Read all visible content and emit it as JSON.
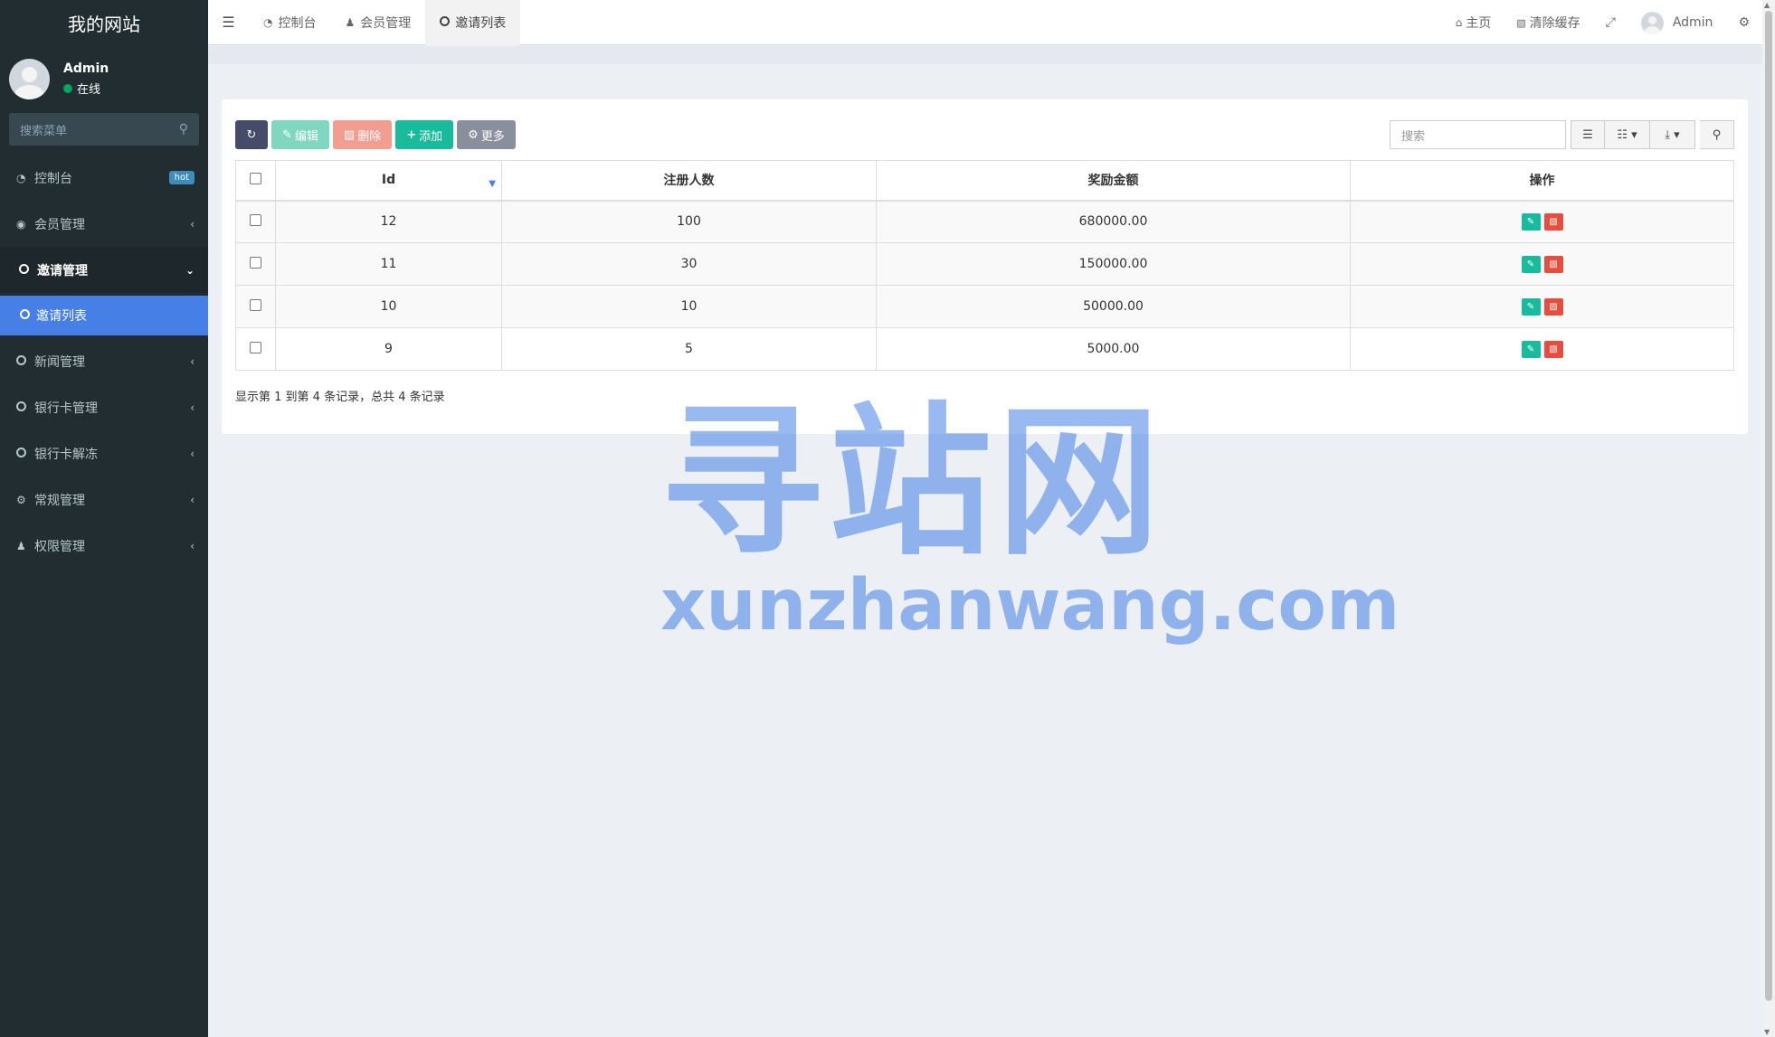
{
  "brand": "我的网站",
  "user": {
    "name": "Admin",
    "status": "在线"
  },
  "sidebar": {
    "search_placeholder": "搜索菜单",
    "items": [
      {
        "label": "控制台",
        "icon": "dashboard-icon",
        "badge": "hot"
      },
      {
        "label": "会员管理",
        "icon": "user-circle-icon"
      },
      {
        "label": "邀请管理",
        "icon": "circle-o-icon",
        "open": true
      },
      {
        "label": "新闻管理",
        "icon": "circle-o-icon"
      },
      {
        "label": "银行卡管理",
        "icon": "circle-o-icon"
      },
      {
        "label": "银行卡解冻",
        "icon": "circle-o-icon"
      },
      {
        "label": "常规管理",
        "icon": "cogs-icon"
      },
      {
        "label": "权限管理",
        "icon": "users-icon"
      }
    ],
    "submenu_active": "邀请列表"
  },
  "topnav": {
    "tabs": [
      {
        "label": "控制台",
        "icon": "dashboard-icon"
      },
      {
        "label": "会员管理",
        "icon": "user-icon"
      },
      {
        "label": "邀请列表",
        "icon": "circle-o-icon",
        "active": true
      }
    ],
    "home": "主页",
    "clear_cache": "清除缓存",
    "admin": "Admin"
  },
  "toolbar": {
    "edit": "编辑",
    "delete": "删除",
    "add": "添加",
    "more": "更多",
    "search_placeholder": "搜索"
  },
  "table": {
    "columns": [
      "Id",
      "注册人数",
      "奖励金额",
      "操作"
    ],
    "rows": [
      {
        "id": "12",
        "count": "100",
        "amount": "680000.00"
      },
      {
        "id": "11",
        "count": "30",
        "amount": "150000.00"
      },
      {
        "id": "10",
        "count": "10",
        "amount": "50000.00"
      },
      {
        "id": "9",
        "count": "5",
        "amount": "5000.00"
      }
    ]
  },
  "pagination_info": "显示第 1 到第 4 条记录，总共 4 条记录",
  "watermark": {
    "cn": "寻站网",
    "en": "xunzhanwang.com"
  },
  "colors": {
    "sidebar_bg": "#222d32",
    "active_blue": "#4680e6",
    "success": "#18bc9c",
    "danger": "#e74c3c"
  }
}
